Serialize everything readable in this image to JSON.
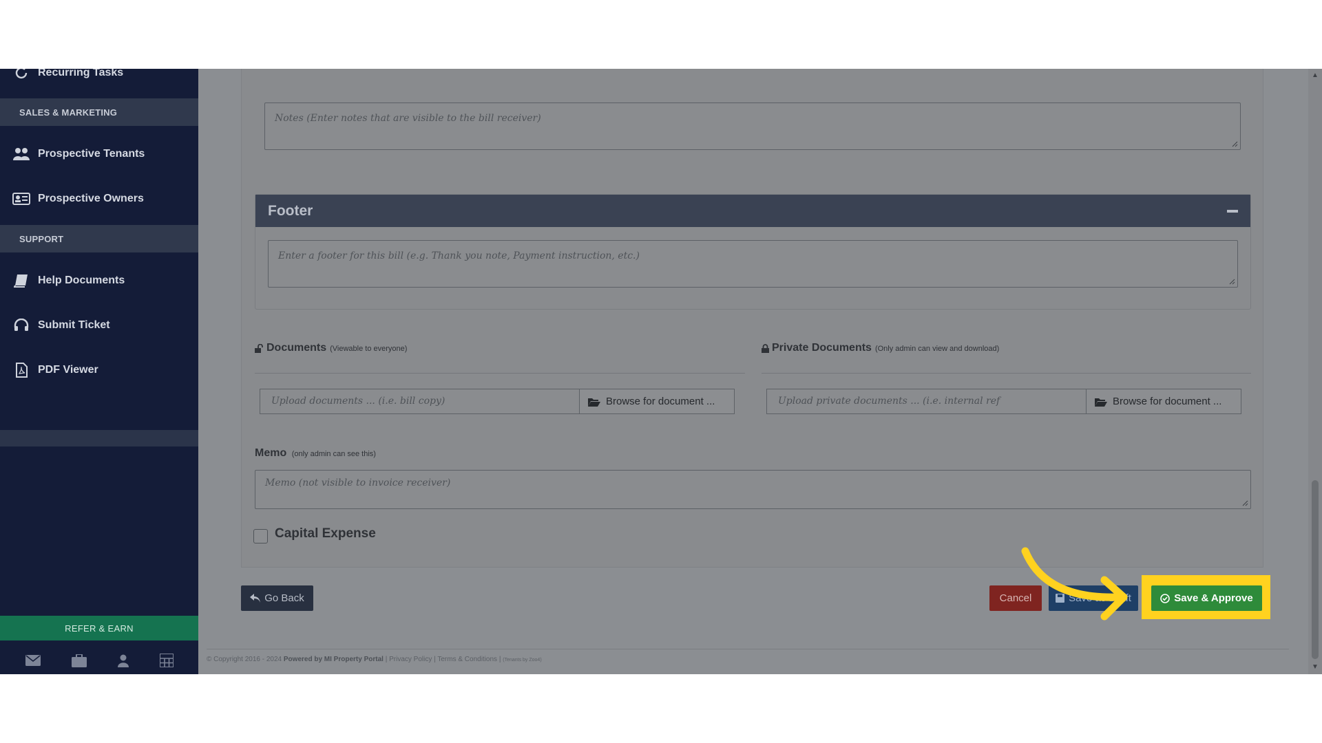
{
  "sidebar": {
    "items_top": [
      {
        "label": "Recurring Tasks",
        "icon": "recurring-icon"
      }
    ],
    "section_sales": "SALES & MARKETING",
    "items_sales": [
      {
        "label": "Prospective Tenants",
        "icon": "users-icon"
      },
      {
        "label": "Prospective Owners",
        "icon": "id-card-icon"
      }
    ],
    "section_support": "SUPPORT",
    "items_support": [
      {
        "label": "Help Documents",
        "icon": "book-icon"
      },
      {
        "label": "Submit Ticket",
        "icon": "headset-icon"
      },
      {
        "label": "PDF Viewer",
        "icon": "pdf-file-icon"
      }
    ],
    "refer_label": "REFER & EARN",
    "bottom_icons": [
      "envelope-icon",
      "briefcase-icon",
      "user-icon",
      "calculator-icon"
    ]
  },
  "form": {
    "notes_placeholder": "Notes (Enter notes that are visible to the bill receiver)",
    "footer_title": "Footer",
    "footer_placeholder": "Enter a footer for this bill (e.g. Thank you note, Payment instruction, etc.)",
    "documents": {
      "title": "Documents",
      "note": "(Viewable to everyone)",
      "upload_placeholder": "Upload documents ... (i.e. bill copy)",
      "browse_label": "Browse for document ..."
    },
    "private_documents": {
      "title": "Private Documents",
      "note": "(Only admin can view and download)",
      "upload_placeholder": "Upload private documents ... (i.e. internal ref",
      "browse_label": "Browse for document ..."
    },
    "memo_label": "Memo",
    "memo_note": "(only admin can see this)",
    "memo_placeholder": "Memo (not visible to invoice receiver)",
    "capital_expense_label": "Capital Expense"
  },
  "actions": {
    "go_back": "Go Back",
    "cancel": "Cancel",
    "save_draft": "Save as Draft",
    "save_approve": "Save & Approve"
  },
  "footer": {
    "copyright": "© Copyright 2016 - 2024",
    "powered_by": "Powered by MI Property Portal",
    "privacy": "Privacy Policy",
    "terms": "Terms & Conditions",
    "tenants_by": "(Tenants by Zoo4)"
  },
  "colors": {
    "sidebar_bg": "#141c38",
    "highlight": "#ffd21f",
    "approve_green": "#2e8b3a",
    "cancel_red": "#7f2420",
    "draft_blue": "#1e3f66"
  }
}
